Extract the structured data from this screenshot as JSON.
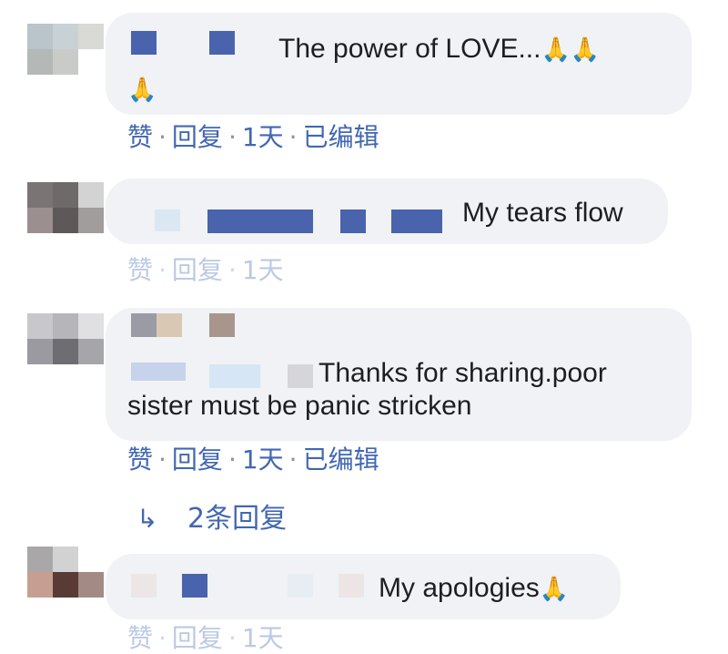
{
  "comments": [
    {
      "text": "The power of LOVE...",
      "emoji_inline": "🙏🙏",
      "emoji_wrap": "🙏",
      "actions": {
        "like": "赞",
        "reply": "回复",
        "time": "1天",
        "edited": "已编辑",
        "separator": "·"
      }
    },
    {
      "text": "My tears flow",
      "actions": {
        "like": "赞",
        "reply": "回复",
        "time": "1天",
        "separator": "·"
      }
    },
    {
      "text": "Thanks for sharing.poor sister must be panic stricken",
      "actions": {
        "like": "赞",
        "reply": "回复",
        "time": "1天",
        "edited": "已编辑",
        "separator": "·"
      },
      "replies_link": "2条回复",
      "replies_arrow": "↳"
    },
    {
      "text": "My apologies",
      "emoji_inline": "🙏",
      "actions": {
        "like": "赞",
        "reply": "回复",
        "time": "1天",
        "separator": "·"
      }
    }
  ],
  "colors": {
    "bubble": "#f0f2f5",
    "link": "#4267b2",
    "text": "#1c1e21"
  }
}
